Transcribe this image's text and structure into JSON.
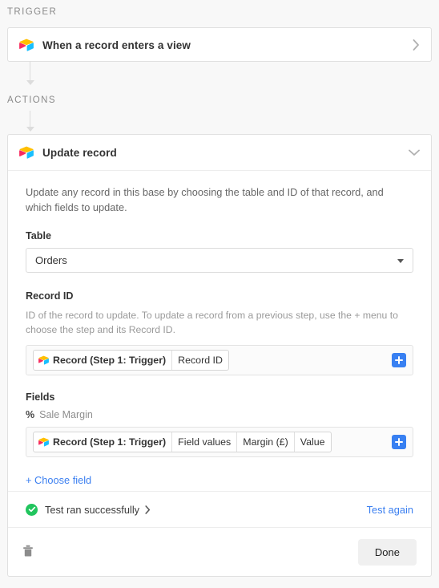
{
  "sections": {
    "trigger_label": "TRIGGER",
    "actions_label": "ACTIONS"
  },
  "trigger_card": {
    "icon": "airtable-logo-icon",
    "title": "When a record enters a view",
    "chevron": "chevron-right-icon"
  },
  "action_card": {
    "icon": "airtable-logo-icon",
    "title": "Update record",
    "chevron": "chevron-down-icon",
    "description": "Update any record in this base by choosing the table and ID of that record, and which fields to update.",
    "table": {
      "label": "Table",
      "value": "Orders",
      "caret": "caret-down-icon"
    },
    "record_id": {
      "label": "Record ID",
      "helper": "ID of the record to update. To update a record from a previous step, use the + menu to choose the step and its Record ID.",
      "tokens": [
        {
          "text": "Record (Step 1: Trigger)",
          "icon": "airtable-logo-icon",
          "primary": true
        },
        {
          "text": "Record ID",
          "primary": false
        }
      ],
      "add_button": "plus-icon"
    },
    "fields": {
      "label": "Fields",
      "sub_field": {
        "type_icon": "%",
        "name": "Sale Margin"
      },
      "tokens": [
        {
          "text": "Record (Step 1: Trigger)",
          "icon": "airtable-logo-icon",
          "primary": true
        },
        {
          "text": "Field values",
          "primary": false
        },
        {
          "text": "Margin (£)",
          "primary": false
        },
        {
          "text": "Value",
          "primary": false
        }
      ],
      "add_button": "plus-icon",
      "choose_field": "+ Choose field"
    },
    "test_row": {
      "status_icon": "check-circle-icon",
      "status_text": "Test ran successfully",
      "status_chevron": "chevron-right-icon",
      "test_again": "Test again"
    },
    "footer": {
      "delete_icon": "trash-icon",
      "done_label": "Done"
    }
  },
  "colors": {
    "accent_blue": "#3880f2",
    "link_blue": "#3b7ff0",
    "success_green": "#22c55e",
    "page_bg": "#f8f8f8",
    "card_bg": "#ffffff"
  }
}
